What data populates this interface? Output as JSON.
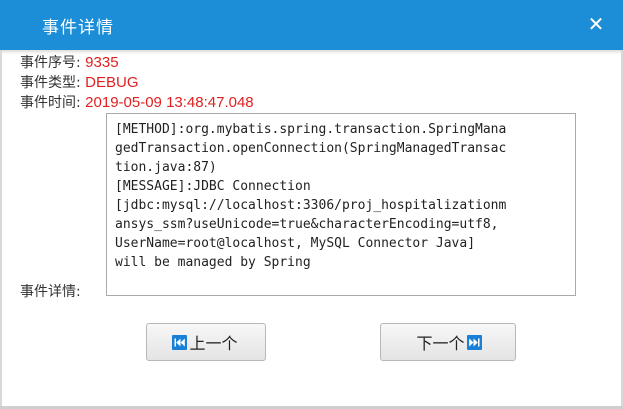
{
  "dialog": {
    "title": "事件详情",
    "close_label": "✕"
  },
  "fields": {
    "seq_label": "事件序号:",
    "seq_value": "9335",
    "type_label": "事件类型:",
    "type_value": "DEBUG",
    "time_label": "事件时间:",
    "time_value": "2019-05-09 13:48:47.048",
    "detail_label": "事件详情:",
    "detail_value": "[METHOD]:org.mybatis.spring.transaction.SpringMana\ngedTransaction.openConnection(SpringManagedTransac\ntion.java:87)\n[MESSAGE]:JDBC Connection\n[jdbc:mysql://localhost:3306/proj_hospitalizationm\nansys_ssm?useUnicode=true&characterEncoding=utf8,\nUserName=root@localhost, MySQL Connector Java]\nwill be managed by Spring"
  },
  "buttons": {
    "prev_label": "上一个",
    "next_label": "下一个"
  },
  "colors": {
    "titlebar": "#1c8ed8",
    "value_text": "#e02020",
    "icon_blue": "#1a7fd6"
  },
  "icons": {
    "prev": "skip-previous-icon",
    "next": "skip-next-icon",
    "close": "close-icon"
  }
}
